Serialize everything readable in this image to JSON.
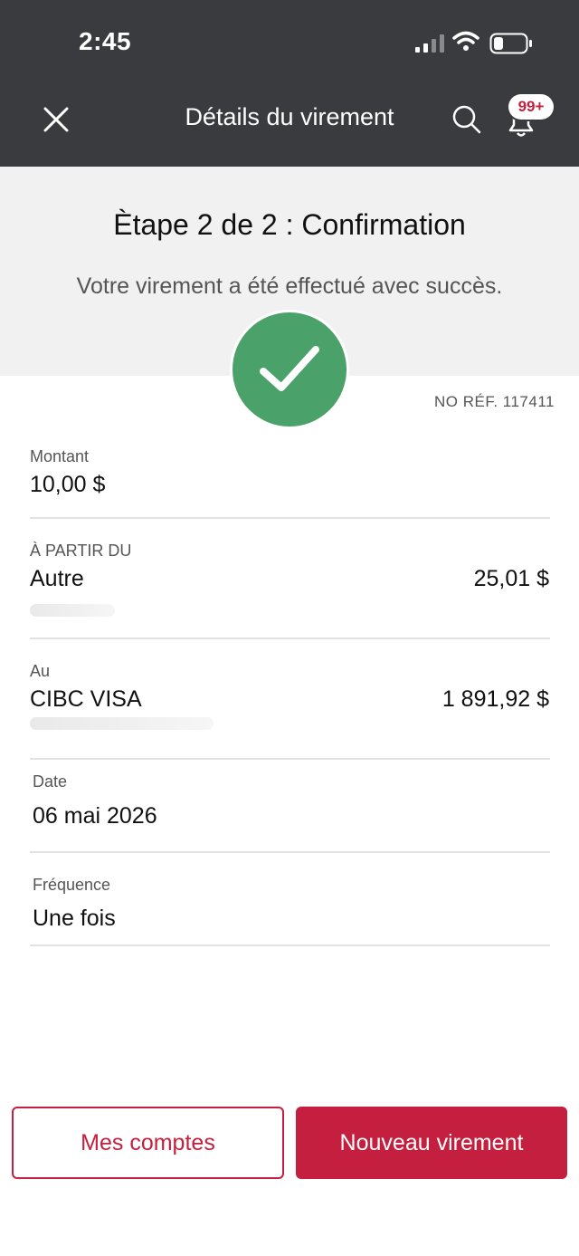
{
  "status_bar": {
    "time": "2:45"
  },
  "header": {
    "title": "Détails du virement",
    "notification_badge": "99+",
    "icons": [
      "close-icon",
      "search-icon",
      "bell-icon"
    ]
  },
  "confirmation": {
    "step": "Ètape 2 de 2 : Confirmation",
    "message": "Votre virement a été effectué avec succès.",
    "reference": "NO RÉF. 117411",
    "icon": "checkmark-icon",
    "icon_color": "#4aa169"
  },
  "details": {
    "amount": {
      "label": "Montant",
      "value": "10,00 $"
    },
    "from": {
      "label": "À PARTIR DU",
      "account": "Autre",
      "balance": "25,01 $"
    },
    "to": {
      "label": "Au",
      "account": "CIBC VISA",
      "balance": "1 891,92 $"
    },
    "date": {
      "label": "Date",
      "value": "06 mai 2026"
    },
    "frequency": {
      "label": "Fréquence",
      "value": "Une fois"
    }
  },
  "actions": {
    "my_accounts": "Mes comptes",
    "new_transfer": "Nouveau virement"
  },
  "colors": {
    "brand": "#c41f3e",
    "header_bg": "#3a3b3e",
    "banner_bg": "#f1f1f1"
  }
}
